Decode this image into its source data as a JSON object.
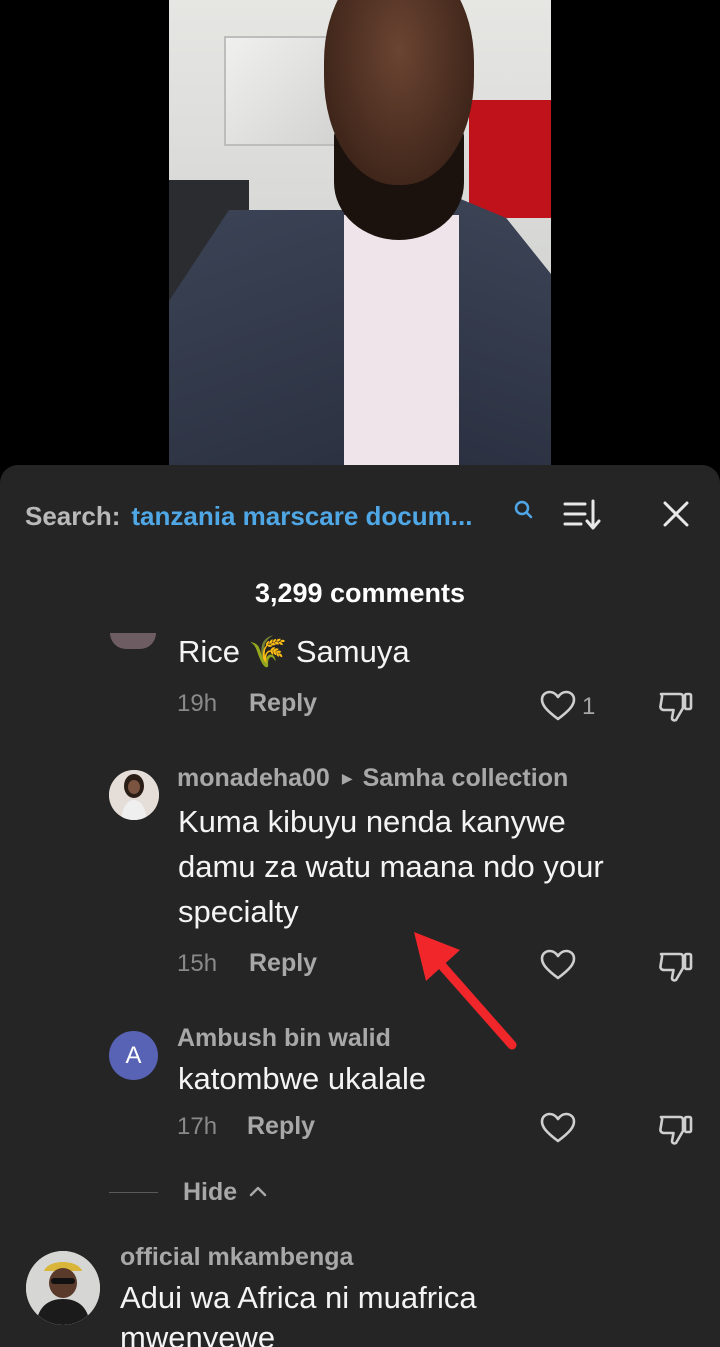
{
  "video": {
    "description_image": "CNN studio presenter video"
  },
  "sheet": {
    "search_label": "Search:",
    "search_query": "tanzania marscare docum...",
    "comments_count": "3,299 comments"
  },
  "comments": [
    {
      "text": "Rice 🌾 Samuya",
      "time": "19h",
      "reply": "Reply",
      "likes": "1"
    },
    {
      "username": "monadeha00",
      "reply_to": "Samha collection",
      "text_line1": "Kuma kibuyu nenda kanywe",
      "text_line2": "damu za watu maana ndo your",
      "text_line3": "specialty",
      "time": "15h",
      "reply": "Reply"
    },
    {
      "username": "Ambush bin walid",
      "avatar_letter": "A",
      "text": "katombwe ukalale",
      "time": "17h",
      "reply": "Reply"
    },
    {
      "username": "official mkambenga",
      "text_line1": "Adui wa Africa ni muafrica",
      "text_line2": "mwenyewe"
    }
  ],
  "replies_toggle": {
    "label": "Hide"
  },
  "colors": {
    "sheet_bg": "#252525",
    "link_blue": "#4fa7e6",
    "annotation_arrow": "#f0262a",
    "avatar_letter_bg": "#5863b6"
  },
  "icons": {
    "search": "search-icon",
    "sort": "sort-icon",
    "close": "close-icon",
    "like": "heart-outline-icon",
    "dislike": "thumbs-down-icon",
    "chevron": "chevron-up-icon"
  }
}
